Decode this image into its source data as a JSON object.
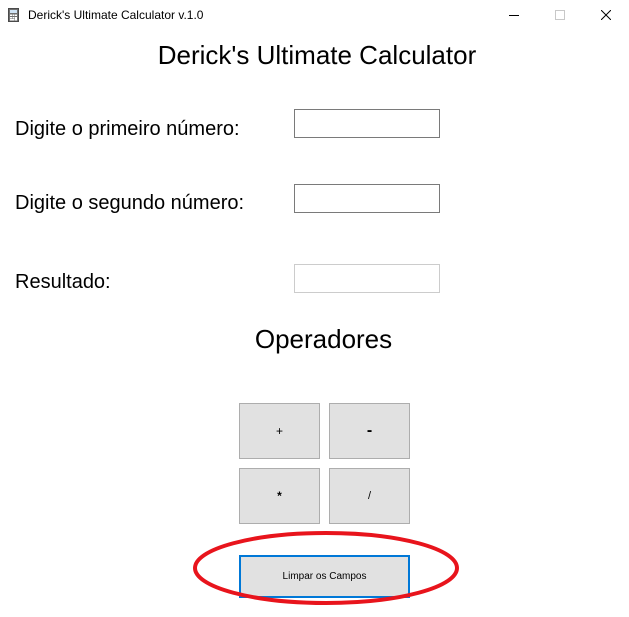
{
  "window": {
    "title": "Derick's Ultimate Calculator v.1.0"
  },
  "main": {
    "heading": "Derick's Ultimate Calculator",
    "first_label": "Digite o primeiro número:",
    "first_value": "",
    "second_label": "Digite o segundo número:",
    "second_value": "",
    "result_label": "Resultado:",
    "result_value": "",
    "operators_heading": "Operadores",
    "operators": {
      "add": "+",
      "subtract": "-",
      "multiply": "*",
      "divide": "/"
    },
    "clear_label": "Limpar os Campos"
  },
  "colors": {
    "button_face": "#e1e1e1",
    "focus_border": "#0078d7",
    "annotation_red": "#e8141c"
  },
  "icons": {
    "app": "calculator-icon",
    "minimize": "minimize-icon",
    "maximize": "maximize-icon",
    "close": "close-icon"
  }
}
